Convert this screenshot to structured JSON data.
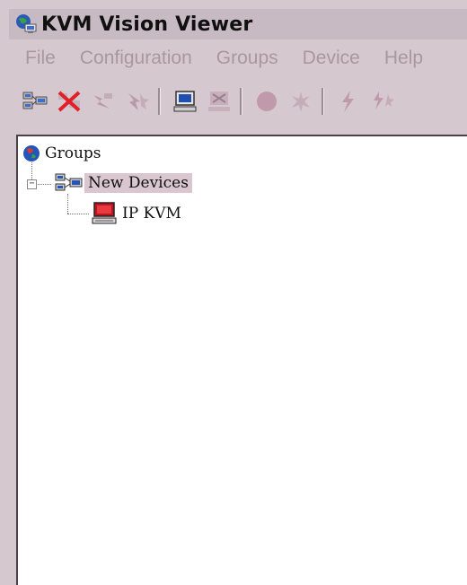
{
  "window": {
    "title": "KVM Vision Viewer",
    "icon": "network-globe-icon"
  },
  "menu": [
    {
      "label": "File"
    },
    {
      "label": "Configuration"
    },
    {
      "label": "Groups"
    },
    {
      "label": "Device"
    },
    {
      "label": "Help"
    }
  ],
  "toolbar": {
    "buttons": [
      "add-group-icon",
      "delete-group-icon",
      "group-lightning-icon",
      "group-star-icon",
      "add-device-icon",
      "delete-device-icon",
      "record-dot-icon",
      "sparkle-icon",
      "lightning-icon",
      "lightning-star-icon"
    ]
  },
  "tree": {
    "root": {
      "label": "Groups",
      "icon": "globe-icon"
    },
    "group": {
      "label": "New Devices",
      "icon": "network-group-icon",
      "expanded": true,
      "selected": true
    },
    "device": {
      "label": "IP KVM",
      "icon": "red-computer-icon"
    }
  },
  "colors": {
    "background": "#d6c8cf",
    "selection": "#d9c6cf",
    "device_red": "#c0141e",
    "menu_text": "#a9979f"
  }
}
